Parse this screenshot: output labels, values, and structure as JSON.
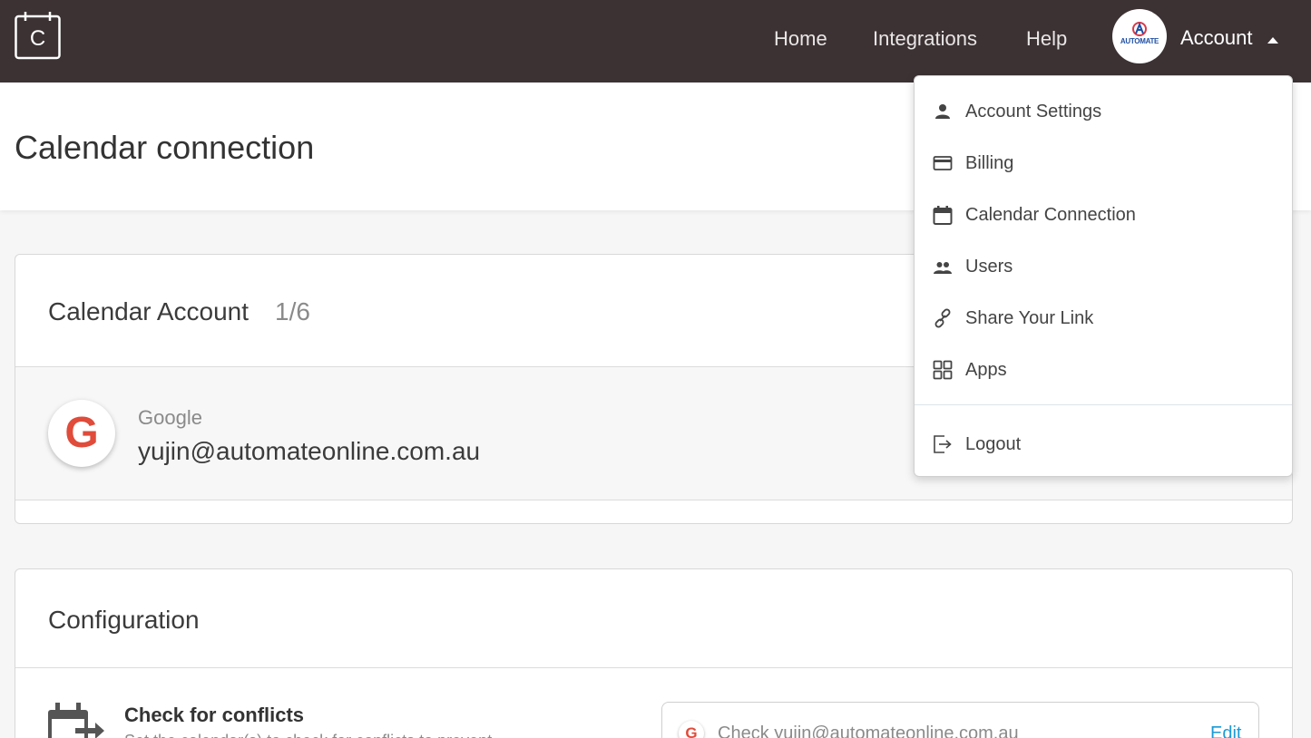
{
  "topbar": {
    "logo_letter": "C",
    "nav": [
      {
        "label": "Home"
      },
      {
        "label": "Integrations"
      },
      {
        "label": "Help"
      }
    ],
    "avatar_text": "AUTOMATE",
    "account_label": "Account"
  },
  "page": {
    "title": "Calendar connection"
  },
  "calendar_account": {
    "title": "Calendar Account",
    "count": "1/6",
    "provider": "Google",
    "email": "yujin@automateonline.com.au",
    "provider_icon": "google-g-icon"
  },
  "configuration": {
    "title": "Configuration",
    "check_conflicts": {
      "title": "Check for conflicts",
      "subtitle": "Set the calendar(s) to check for conflicts to prevent",
      "check_text": "Check yujin@automateonline.com.au",
      "edit_label": "Edit"
    }
  },
  "account_menu": {
    "items": [
      {
        "label": "Account Settings",
        "icon": "person-icon"
      },
      {
        "label": "Billing",
        "icon": "credit-card-icon"
      },
      {
        "label": "Calendar Connection",
        "icon": "calendar-icon"
      },
      {
        "label": "Users",
        "icon": "people-icon"
      },
      {
        "label": "Share Your Link",
        "icon": "link-icon"
      },
      {
        "label": "Apps",
        "icon": "grid-icon"
      }
    ],
    "logout_label": "Logout"
  },
  "colors": {
    "topbar": "#3c3234",
    "link_blue": "#1a9ad6",
    "google_red": "#e04b3a"
  }
}
